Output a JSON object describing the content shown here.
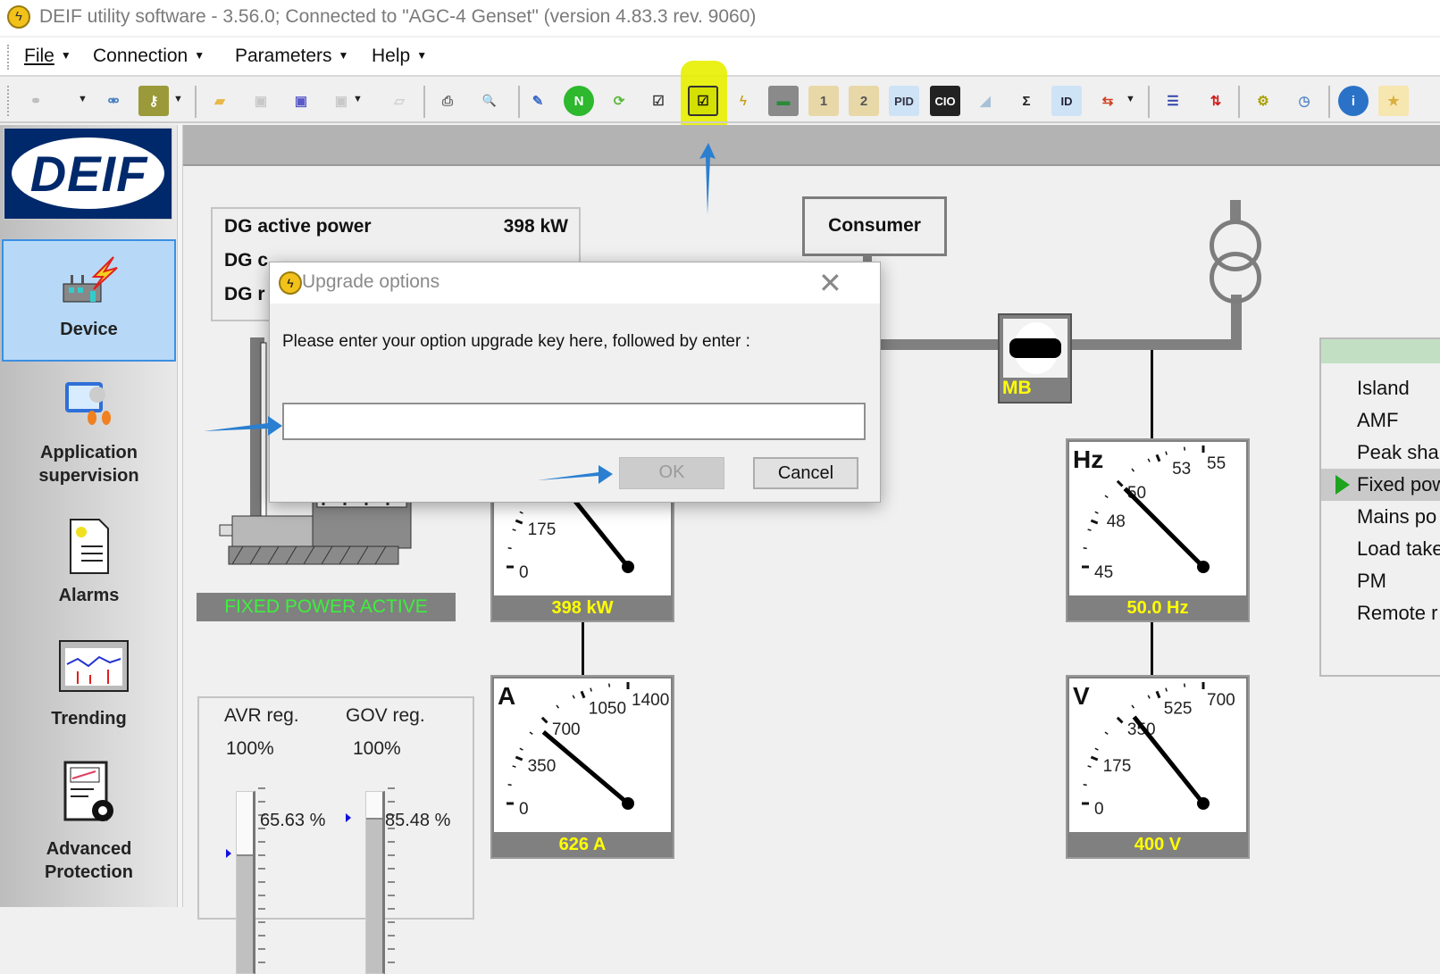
{
  "window": {
    "title": "DEIF utility software - 3.56.0; Connected to \"AGC-4 Genset\" (version 4.83.3 rev. 9060)",
    "app_icon": "deif-lightning-icon"
  },
  "menu": [
    {
      "label": "File"
    },
    {
      "label": "Connection"
    },
    {
      "label": "Parameters"
    },
    {
      "label": "Help"
    }
  ],
  "toolbar": {
    "buttons": [
      {
        "name": "connect-icon",
        "glyph": "⚭",
        "color": "#bbbbbb",
        "bg": ""
      },
      {
        "name": "disconnect-icon",
        "glyph": "⚮",
        "color": "#4a7fc0",
        "bg": ""
      },
      {
        "name": "key-icon",
        "glyph": "⚷",
        "color": "#ffffff",
        "bg": "#9a9a3a"
      },
      {
        "name": "open-folder-icon",
        "glyph": "▰",
        "color": "#e8b84a",
        "bg": ""
      },
      {
        "name": "save-icon",
        "glyph": "▣",
        "color": "#c8c8c8",
        "bg": ""
      },
      {
        "name": "save-as-icon",
        "glyph": "▣",
        "color": "#5a5ac8",
        "bg": ""
      },
      {
        "name": "save-copy-icon",
        "glyph": "▣",
        "color": "#c8c8c8",
        "bg": ""
      },
      {
        "name": "open-disabled-icon",
        "glyph": "▱",
        "color": "#d0d0d0",
        "bg": ""
      },
      {
        "name": "print-icon",
        "glyph": "⎙",
        "color": "#666666",
        "bg": ""
      },
      {
        "name": "print-preview-icon",
        "glyph": "🔍",
        "color": "#666666",
        "bg": ""
      },
      {
        "name": "design-ruler-icon",
        "glyph": "✎",
        "color": "#3a6ac8",
        "bg": ""
      },
      {
        "name": "n-green-icon",
        "glyph": "N",
        "color": "#ffffff",
        "bg": "#2db82d"
      },
      {
        "name": "refresh-icon",
        "glyph": "⟳",
        "color": "#5ab83a",
        "bg": ""
      },
      {
        "name": "add-check-icon",
        "glyph": "☑",
        "color": "#333333",
        "bg": ""
      },
      {
        "name": "upgrade-options-icon",
        "glyph": "☑",
        "color": "#111111",
        "bg": ""
      },
      {
        "name": "lightning-cycle-icon",
        "glyph": "ϟ",
        "color": "#c8a020",
        "bg": ""
      },
      {
        "name": "display-unit-icon",
        "glyph": "▬",
        "color": "#2a8a3a",
        "bg": "#8a8a8a"
      },
      {
        "name": "hand-1-icon",
        "glyph": "1",
        "color": "#555555",
        "bg": "#e8d8a8"
      },
      {
        "name": "hand-2-icon",
        "glyph": "2",
        "color": "#555555",
        "bg": "#e8d8a8"
      },
      {
        "name": "pid-icon",
        "glyph": "PID",
        "color": "#334",
        "bg": "#cfe3f7"
      },
      {
        "name": "cio-icon",
        "glyph": "CIO",
        "color": "#ffffff",
        "bg": "#222222"
      },
      {
        "name": "ramp-icon",
        "glyph": "◢",
        "color": "#a8c0d8",
        "bg": ""
      },
      {
        "name": "sum-icon",
        "glyph": "Σ",
        "color": "#222222",
        "bg": ""
      },
      {
        "name": "id-icon",
        "glyph": "ID",
        "color": "#223",
        "bg": "#cfe3f7"
      },
      {
        "name": "transfer-arrows-icon",
        "glyph": "⇆",
        "color": "#d04020",
        "bg": ""
      },
      {
        "name": "list-icon",
        "glyph": "☰",
        "color": "#3344aa",
        "bg": ""
      },
      {
        "name": "updown-arrows-icon",
        "glyph": "⇅",
        "color": "#d02020",
        "bg": ""
      },
      {
        "name": "gear-icon",
        "glyph": "⚙",
        "color": "#a8a000",
        "bg": ""
      },
      {
        "name": "clock-sync-icon",
        "glyph": "◷",
        "color": "#5a8ac8",
        "bg": ""
      },
      {
        "name": "info-icon",
        "glyph": "i",
        "color": "#ffffff",
        "bg": "#2a72c8"
      },
      {
        "name": "shield-icon",
        "glyph": "★",
        "color": "#d8b040",
        "bg": "#f6e6b0"
      }
    ]
  },
  "sidebar": {
    "logo": "DEIF",
    "items": [
      {
        "label": "Device",
        "selected": true
      },
      {
        "label": "Application",
        "label2": "supervision"
      },
      {
        "label": "Alarms"
      },
      {
        "label": "Trending"
      },
      {
        "label": "Advanced",
        "label2": "Protection"
      }
    ]
  },
  "info": {
    "rows": [
      {
        "label": "DG active power",
        "value": "398 kW"
      },
      {
        "label": "DG c",
        "value": ""
      },
      {
        "label": "DG r",
        "value": ""
      }
    ]
  },
  "diagram": {
    "consumer": "Consumer",
    "breaker": "MB",
    "status": "FIXED POWER ACTIVE"
  },
  "gauges": {
    "kw": {
      "unit": "",
      "reading": "398 kW",
      "needle_fraction": 0.569,
      "labels": [
        {
          "text": "0",
          "f": 0
        },
        {
          "text": "175",
          "f": 0.25
        }
      ]
    },
    "a": {
      "unit": "A",
      "reading": "626 A",
      "needle_fraction": 0.447,
      "labels": [
        {
          "text": "0",
          "f": 0
        },
        {
          "text": "350",
          "f": 0.25
        },
        {
          "text": "700",
          "f": 0.5
        },
        {
          "text": "1050",
          "f": 0.75
        },
        {
          "text": "1400",
          "f": 1
        }
      ]
    },
    "hz": {
      "unit": "Hz",
      "reading": "50.0 Hz",
      "needle_fraction": 0.5,
      "labels": [
        {
          "text": "45",
          "f": 0
        },
        {
          "text": "48",
          "f": 0.3
        },
        {
          "text": "50",
          "f": 0.5
        },
        {
          "text": "53",
          "f": 0.8
        },
        {
          "text": "55",
          "f": 1
        }
      ]
    },
    "v": {
      "unit": "V",
      "reading": "400 V",
      "needle_fraction": 0.571,
      "labels": [
        {
          "text": "0",
          "f": 0
        },
        {
          "text": "175",
          "f": 0.25
        },
        {
          "text": "350",
          "f": 0.5
        },
        {
          "text": "525",
          "f": 0.75
        },
        {
          "text": "700",
          "f": 1
        }
      ]
    }
  },
  "modes": {
    "items": [
      {
        "label": "Island"
      },
      {
        "label": "AMF"
      },
      {
        "label": "Peak sha"
      },
      {
        "label": "Fixed pow",
        "selected": true
      },
      {
        "label": "Mains po"
      },
      {
        "label": "Load take"
      },
      {
        "label": "PM"
      },
      {
        "label": "Remote r"
      }
    ]
  },
  "regulators": {
    "avr": {
      "title": "AVR reg.",
      "limit": "100%",
      "value_text": "65.63 %",
      "value": 65.63
    },
    "gov": {
      "title": "GOV reg.",
      "limit": "100%",
      "value_text": "85.48 %",
      "value": 85.48
    }
  },
  "dialog": {
    "title": "Upgrade options",
    "message": "Please enter your option upgrade key here, followed by enter :",
    "input_value": "",
    "ok_label": "OK",
    "cancel_label": "Cancel",
    "close_glyph": "✕"
  },
  "colors": {
    "annotation_arrow": "#2a7fd0",
    "highlight": "#e8f000",
    "readout": "#ffff00"
  }
}
